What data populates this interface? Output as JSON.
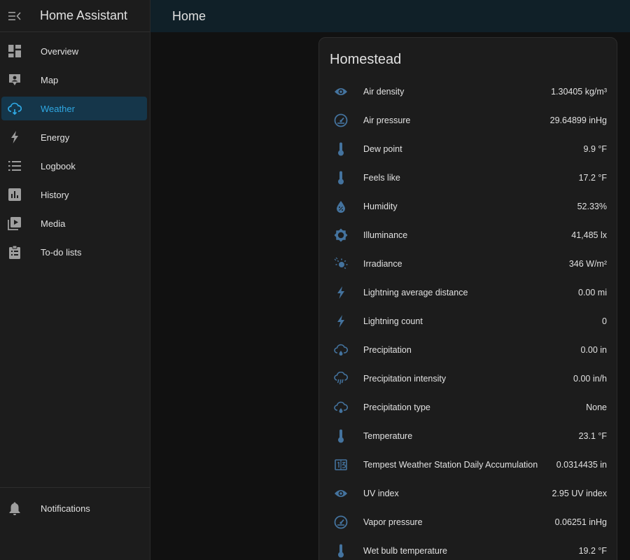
{
  "app": {
    "title": "Home Assistant"
  },
  "colors": {
    "accent": "#2fa8e3",
    "icon_blue": "#44739e",
    "sidebar_icon": "#9e9e9e"
  },
  "sidebar": {
    "items": [
      {
        "label": "Overview",
        "icon": "view-dashboard-icon",
        "active": false
      },
      {
        "label": "Map",
        "icon": "map-icon",
        "active": false
      },
      {
        "label": "Weather",
        "icon": "cloud-icon",
        "active": true
      },
      {
        "label": "Energy",
        "icon": "lightning-icon",
        "active": false
      },
      {
        "label": "Logbook",
        "icon": "list-icon",
        "active": false
      },
      {
        "label": "History",
        "icon": "chart-bar-icon",
        "active": false
      },
      {
        "label": "Media",
        "icon": "media-play-icon",
        "active": false
      },
      {
        "label": "To-do lists",
        "icon": "clipboard-list-icon",
        "active": false
      }
    ],
    "notifications": {
      "label": "Notifications",
      "icon": "bell-icon"
    }
  },
  "header": {
    "title": "Home"
  },
  "card": {
    "title": "Homestead",
    "rows": [
      {
        "name": "Air density",
        "value": "1.30405 kg/m³",
        "icon": "eye-icon"
      },
      {
        "name": "Air pressure",
        "value": "29.64899 inHg",
        "icon": "gauge-icon"
      },
      {
        "name": "Dew point",
        "value": "9.9 °F",
        "icon": "thermometer-icon"
      },
      {
        "name": "Feels like",
        "value": "17.2 °F",
        "icon": "thermometer-icon"
      },
      {
        "name": "Humidity",
        "value": "52.33%",
        "icon": "water-percent-icon"
      },
      {
        "name": "Illuminance",
        "value": "41,485 lx",
        "icon": "brightness-icon"
      },
      {
        "name": "Irradiance",
        "value": "346 W/m²",
        "icon": "sun-rays-icon"
      },
      {
        "name": "Lightning average distance",
        "value": "0.00 mi",
        "icon": "lightning-icon"
      },
      {
        "name": "Lightning count",
        "value": "0",
        "icon": "lightning-icon"
      },
      {
        "name": "Precipitation",
        "value": "0.00 in",
        "icon": "weather-rainy-icon"
      },
      {
        "name": "Precipitation intensity",
        "value": "0.00 in/h",
        "icon": "weather-pouring-icon"
      },
      {
        "name": "Precipitation type",
        "value": "None",
        "icon": "weather-rainy-icon"
      },
      {
        "name": "Temperature",
        "value": "23.1 °F",
        "icon": "thermometer-icon"
      },
      {
        "name": "Tempest Weather Station Daily Accumulation",
        "value": "0.0314435 in",
        "icon": "counter-icon"
      },
      {
        "name": "UV index",
        "value": "2.95 UV index",
        "icon": "eye-icon"
      },
      {
        "name": "Vapor pressure",
        "value": "0.06251 inHg",
        "icon": "gauge-icon"
      },
      {
        "name": "Wet bulb temperature",
        "value": "19.2 °F",
        "icon": "thermometer-icon"
      }
    ]
  }
}
